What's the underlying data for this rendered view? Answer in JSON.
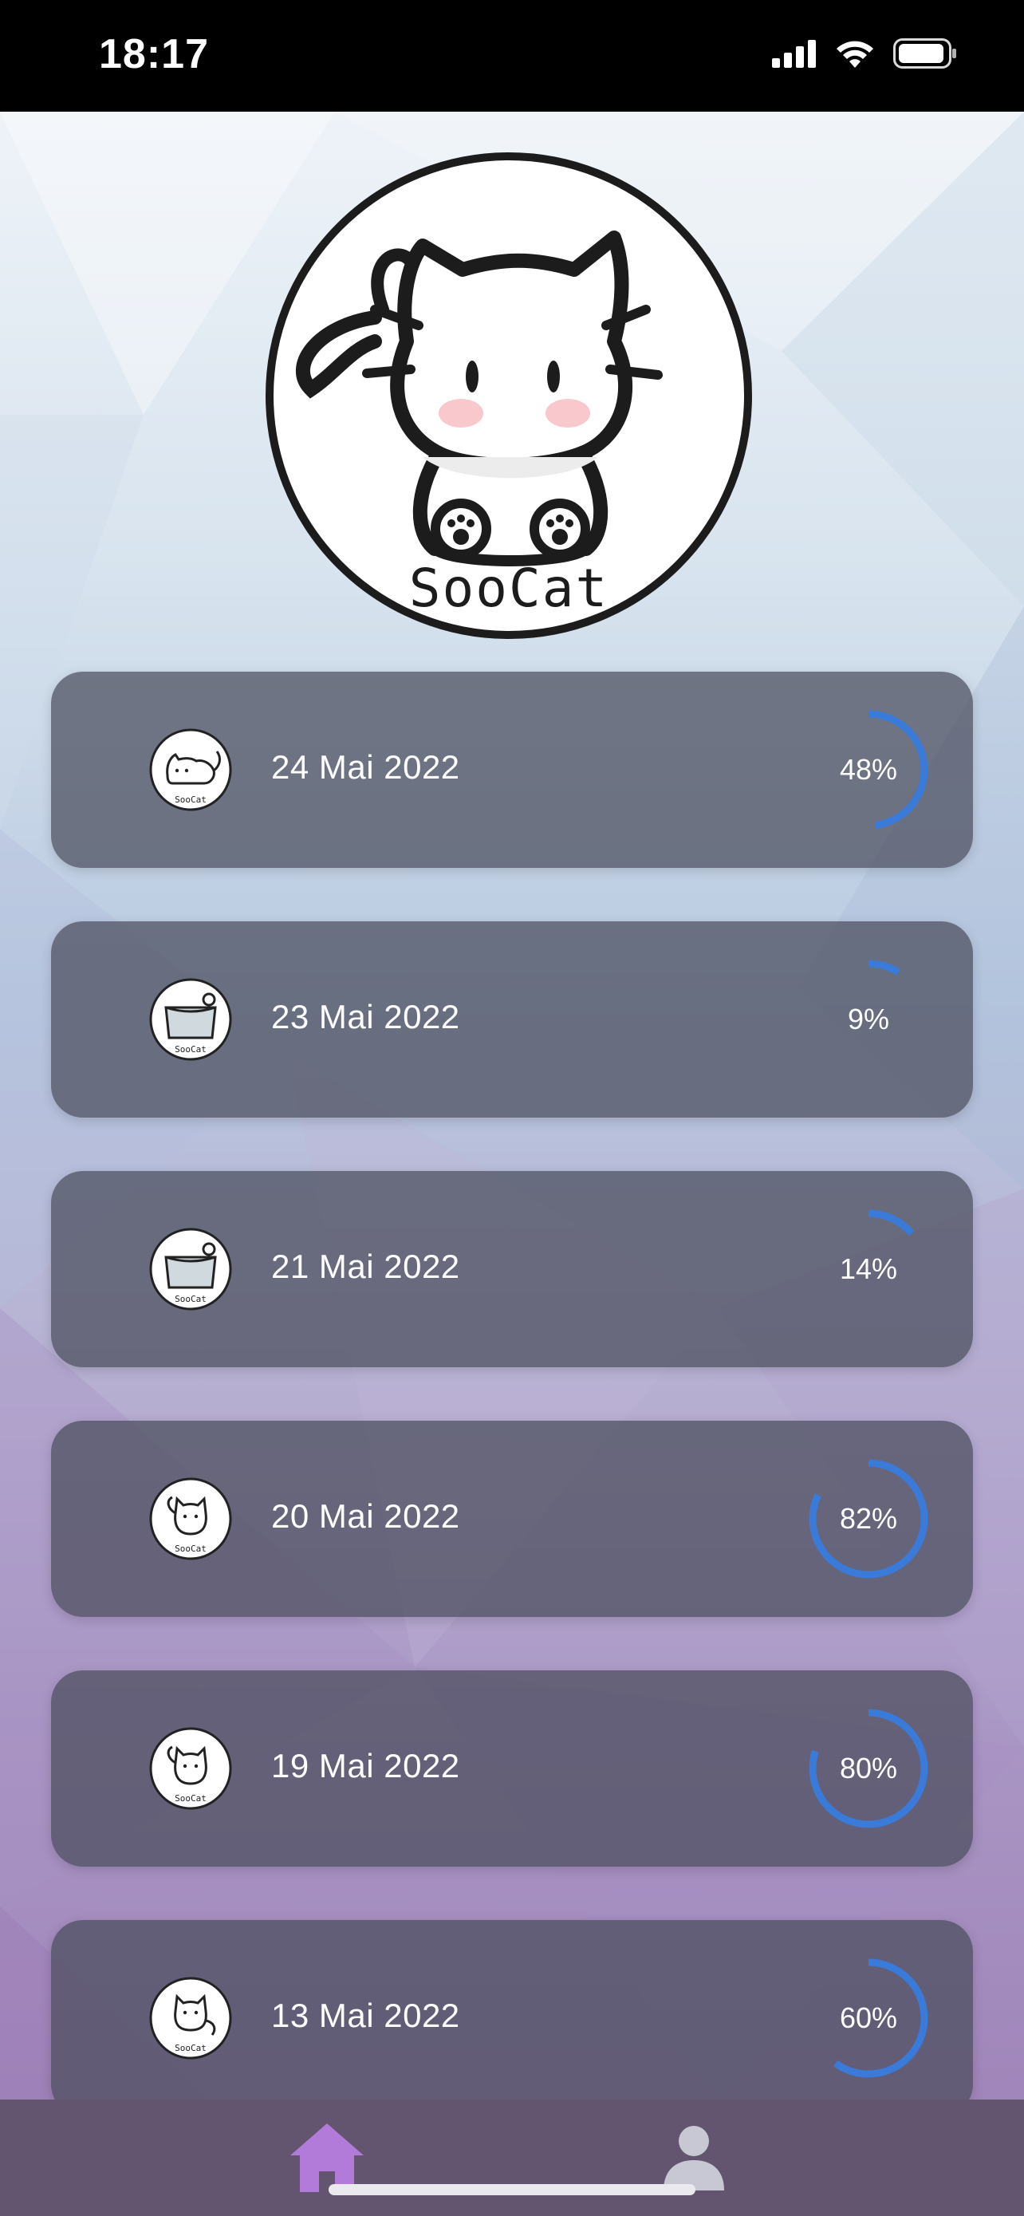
{
  "status_bar": {
    "time": "18:17"
  },
  "logo": {
    "text": "SooCat"
  },
  "sessions": [
    {
      "date": "24 Mai 2022",
      "percent": 48,
      "percent_label": "48%",
      "avatar": "cat-lying-avatar"
    },
    {
      "date": "23 Mai 2022",
      "percent": 9,
      "percent_label": "9%",
      "avatar": "litter-box-avatar"
    },
    {
      "date": "21 Mai 2022",
      "percent": 14,
      "percent_label": "14%",
      "avatar": "litter-box-avatar"
    },
    {
      "date": "20 Mai 2022",
      "percent": 82,
      "percent_label": "82%",
      "avatar": "cat-sitting-avatar"
    },
    {
      "date": "19 Mai 2022",
      "percent": 80,
      "percent_label": "80%",
      "avatar": "cat-sitting-avatar"
    },
    {
      "date": "13 Mai 2022",
      "percent": 60,
      "percent_label": "60%",
      "avatar": "cat-standing-avatar"
    }
  ],
  "tab_bar": {
    "items": [
      {
        "icon": "home-icon",
        "active": true
      },
      {
        "icon": "profile-icon",
        "active": false
      }
    ]
  },
  "colors": {
    "progress": "#3a7ad8",
    "card": "#4a4c5c",
    "tab_active": "#b27bd9",
    "tab_inactive": "#c8c8d4"
  }
}
